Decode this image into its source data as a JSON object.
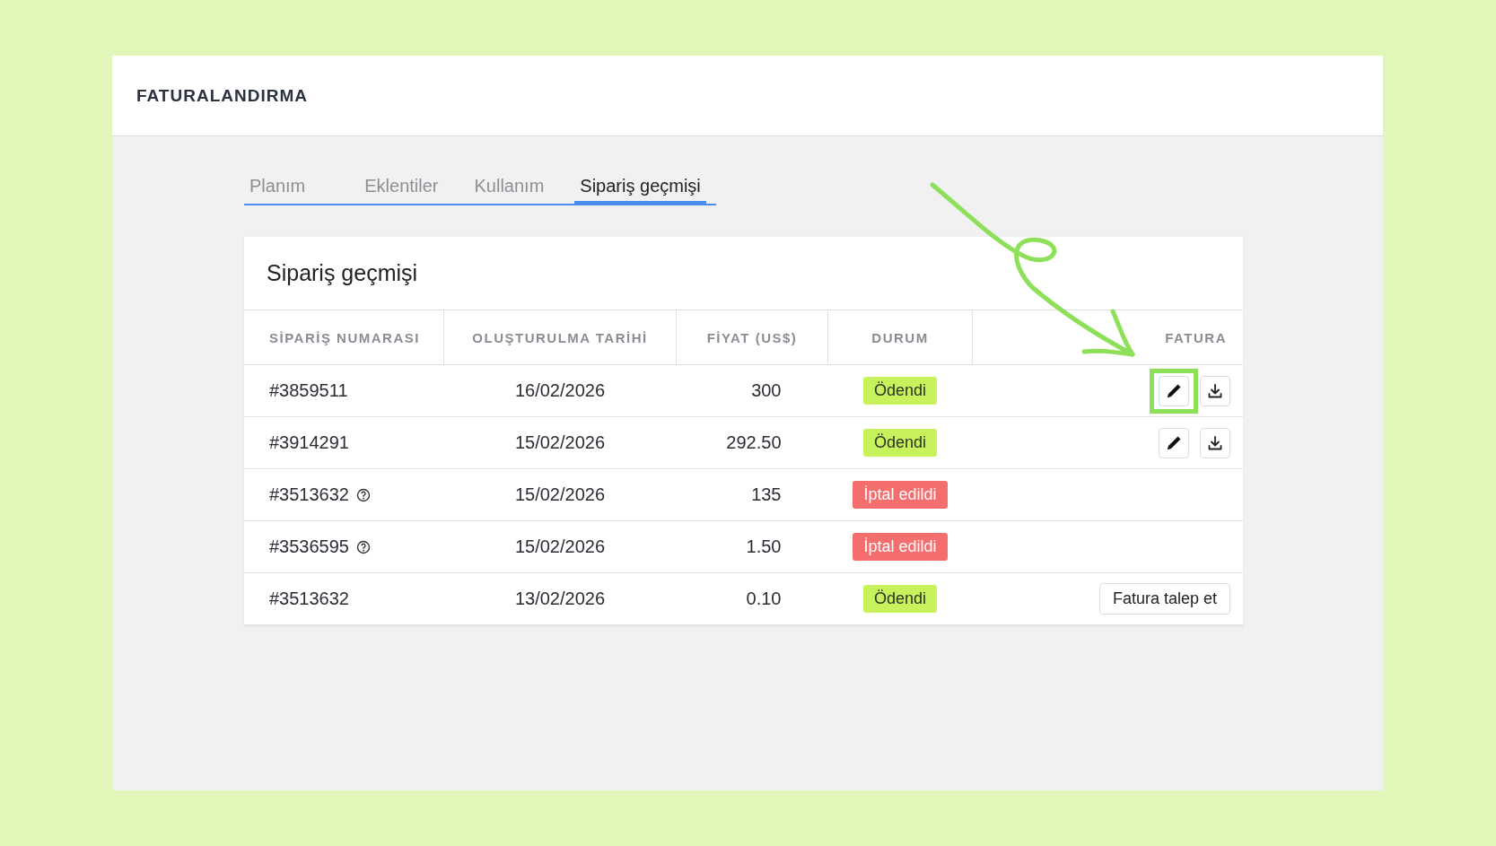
{
  "page": {
    "title": "FATURALANDIRMA"
  },
  "tabs": [
    {
      "label": "Planım",
      "selected": false
    },
    {
      "label": "Eklentiler",
      "selected": false
    },
    {
      "label": "Kullanım",
      "selected": false
    },
    {
      "label": "Sipariş geçmişi",
      "selected": true
    }
  ],
  "card": {
    "title": "Sipariş geçmişi"
  },
  "table": {
    "columns": [
      "SİPARİŞ NUMARASI",
      "OLUŞTURULMA TARİHİ",
      "FİYAT (US$)",
      "DURUM",
      "FATURA"
    ],
    "rows": [
      {
        "order": "#3859511",
        "help": false,
        "date": "16/02/2026",
        "price": "300",
        "status": {
          "label": "Ödendi",
          "kind": "paid",
          "color": "#c8f25c"
        },
        "invoice": {
          "kind": "actions",
          "highlighted": true
        }
      },
      {
        "order": "#3914291",
        "help": false,
        "date": "15/02/2026",
        "price": "292.50",
        "status": {
          "label": "Ödendi",
          "kind": "paid",
          "color": "#c8f25c"
        },
        "invoice": {
          "kind": "actions",
          "highlighted": false
        }
      },
      {
        "order": "#3513632",
        "help": true,
        "date": "15/02/2026",
        "price": "135",
        "status": {
          "label": "İptal edildi",
          "kind": "cancelled",
          "color": "#f46e6e"
        }
      },
      {
        "order": "#3536595",
        "help": true,
        "date": "15/02/2026",
        "price": "1.50",
        "status": {
          "label": "İptal edildi",
          "kind": "cancelled",
          "color": "#f46e6e"
        }
      },
      {
        "order": "#3513632",
        "help": false,
        "date": "13/02/2026",
        "price": "0.10",
        "status": {
          "label": "Ödendi",
          "kind": "paid",
          "color": "#c8f25c"
        },
        "invoice": {
          "kind": "request",
          "label": "Fatura talep et"
        }
      }
    ]
  }
}
